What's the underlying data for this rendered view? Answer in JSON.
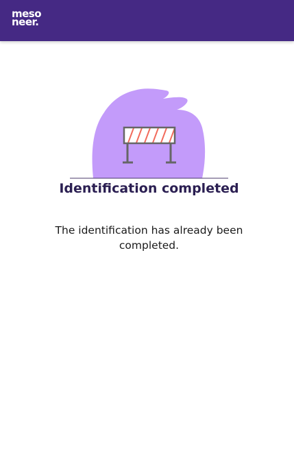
{
  "header": {
    "logo_line1": "meso",
    "logo_line2": "neer."
  },
  "illustration": {
    "icon": "road-barrier-icon",
    "blob_color": "#c39bfa",
    "stripe_color": "#f26a5b",
    "frame_color": "#666666"
  },
  "main": {
    "title": "Identification completed",
    "message_line1": "The identification has already been",
    "message_line2": "completed."
  },
  "colors": {
    "header_bg": "#452984",
    "title": "#2b1f52"
  }
}
